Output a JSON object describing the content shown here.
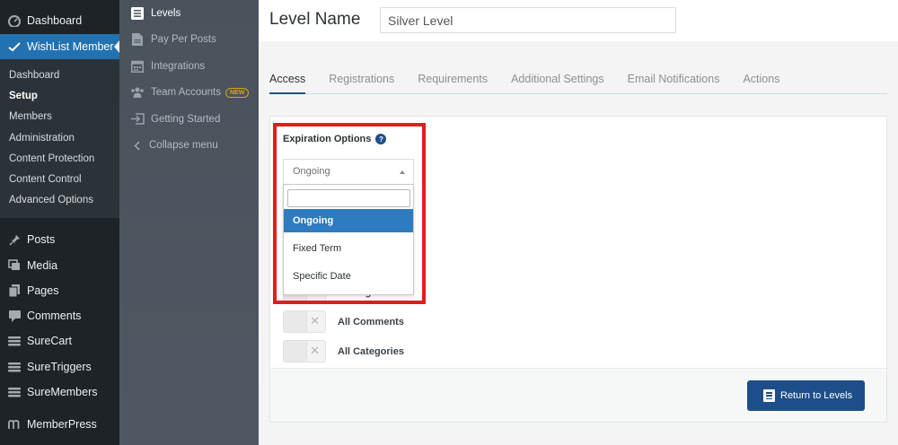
{
  "wp_sidebar": {
    "dashboard": {
      "label": "Dashboard",
      "icon": "dashboard-icon"
    },
    "wishlist": {
      "label": "WishList Member",
      "icon": "checkmark-icon"
    },
    "submenu": [
      {
        "label": "Dashboard",
        "current": false
      },
      {
        "label": "Setup",
        "current": true
      },
      {
        "label": "Members",
        "current": false
      },
      {
        "label": "Administration",
        "current": false
      },
      {
        "label": "Content Protection",
        "current": false
      },
      {
        "label": "Content Control",
        "current": false
      },
      {
        "label": "Advanced Options",
        "current": false
      }
    ],
    "menu": [
      {
        "label": "Posts",
        "icon": "pin-icon"
      },
      {
        "label": "Media",
        "icon": "media-icon"
      },
      {
        "label": "Pages",
        "icon": "pages-icon"
      },
      {
        "label": "Comments",
        "icon": "comment-icon"
      },
      {
        "label": "SureCart",
        "icon": "surecart-icon"
      },
      {
        "label": "SureTriggers",
        "icon": "suretriggers-icon"
      },
      {
        "label": "SureMembers",
        "icon": "suremembers-icon"
      },
      {
        "label": "MemberPress",
        "icon": "memberpress-icon"
      }
    ]
  },
  "wl_nav": {
    "items": [
      {
        "label": "Levels",
        "icon": "levels-icon"
      },
      {
        "label": "Pay Per Posts",
        "icon": "document-icon"
      },
      {
        "label": "Integrations",
        "icon": "calendar-grid-icon"
      },
      {
        "label": "Team Accounts",
        "icon": "team-icon"
      },
      {
        "label": "Getting Started",
        "icon": "sign-in-icon"
      }
    ],
    "new_badge": "NEW",
    "collapse": "Collapse menu"
  },
  "header": {
    "title": "Level Name",
    "level_name_value": "Silver Level"
  },
  "tabs": [
    "Access",
    "Registrations",
    "Requirements",
    "Additional Settings",
    "Email Notifications",
    "Actions"
  ],
  "expiration": {
    "label": "Expiration Options",
    "help": "?",
    "selected": "Ongoing",
    "options": [
      "Ongoing",
      "Fixed Term",
      "Specific Date"
    ]
  },
  "toggles": [
    {
      "label": "All Pages"
    },
    {
      "label": "All Comments"
    },
    {
      "label": "All Categories"
    }
  ],
  "return_button": "Return to Levels",
  "colors": {
    "accent": "#1d4e89",
    "highlight": "#dd1f1f",
    "selected_option": "#2e7bc0"
  }
}
